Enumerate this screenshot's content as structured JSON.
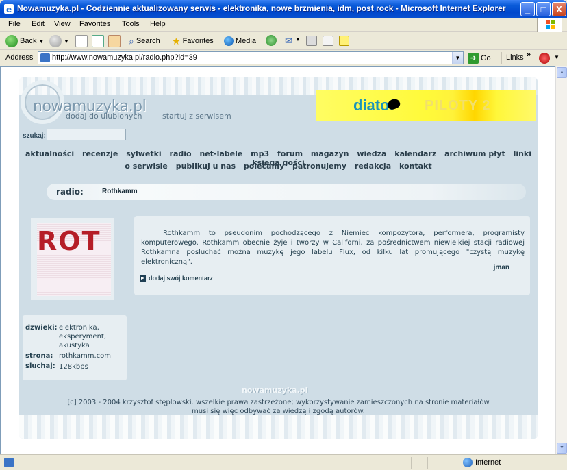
{
  "window": {
    "title": "Nowamuzyka.pl - Codziennie aktualizowany serwis - elektronika, nowe brzmienia, idm, post rock - Microsoft Internet Explorer",
    "minimize": "_",
    "maximize": "□",
    "close": "X"
  },
  "menu": [
    "File",
    "Edit",
    "View",
    "Favorites",
    "Tools",
    "Help"
  ],
  "toolbar": {
    "back": "Back",
    "search": "Search",
    "favorites": "Favorites",
    "media": "Media"
  },
  "address": {
    "label": "Address",
    "url": "http://www.nowamuzyka.pl/radio.php?id=39",
    "go": "Go",
    "links": "Links"
  },
  "page": {
    "logo": "nowamuzyka.pl",
    "header_links": [
      "dodaj do ulubionych",
      "startuj z serwisem"
    ],
    "banner": {
      "brand": "diatof",
      "text": "PILOTY 2"
    },
    "search_label": "szukaj:",
    "search_value": "",
    "nav_row1": [
      "aktualności",
      "recenzje",
      "sylwetki",
      "radio",
      "net-labele",
      "mp3",
      "forum",
      "magazyn",
      "wiedza",
      "kalendarz",
      "archiwum płyt",
      "linki",
      "księga gości"
    ],
    "nav_row2": [
      "o serwisie",
      "publikuj u nas",
      "polecamy",
      "patronujemy",
      "redakcja",
      "kontakt"
    ],
    "radio_label": "radio:",
    "radio_name": "Rothkamm",
    "art_text": "ROT",
    "description": "Rothkamm to pseudonim pochodzącego z Niemiec kompozytora, performera, programisty komputerowego. Rothkamm obecnie żyje i tworzy w Californi, za pośrednictwem niewielkiej stacji radiowej Rothkamna posłuchać można muzykę jego labelu Flux, od kilku lat promującego \"czystą muzykę elektroniczną\".",
    "author": "jman",
    "comment_link": "dodaj swój komentarz",
    "info": {
      "dzwieki_label": "dzwieki:",
      "dzwieki_value": [
        "elektronika,",
        "eksperyment,",
        "akustyka"
      ],
      "strona_label": "strona:",
      "strona_value": "rothkamm.com",
      "sluchaj_label": "sluchaj:",
      "sluchaj_value": "128kbps"
    },
    "footer_logo": "nowamuzyka.pl",
    "footer_line1": "[c] 2003 - 2004 krzysztof stęplowski. wszelkie prawa zastrzeżone; wykorzystywanie zamieszczonych na stronie materiałów",
    "footer_line2": "musi się więc odbywać za wiedzą i zgodą autorów."
  },
  "status": {
    "zone": "Internet"
  },
  "colors": {
    "accent": "#0a5bd9",
    "page_bg": "#cfdde6",
    "art_red": "#b51d27"
  }
}
